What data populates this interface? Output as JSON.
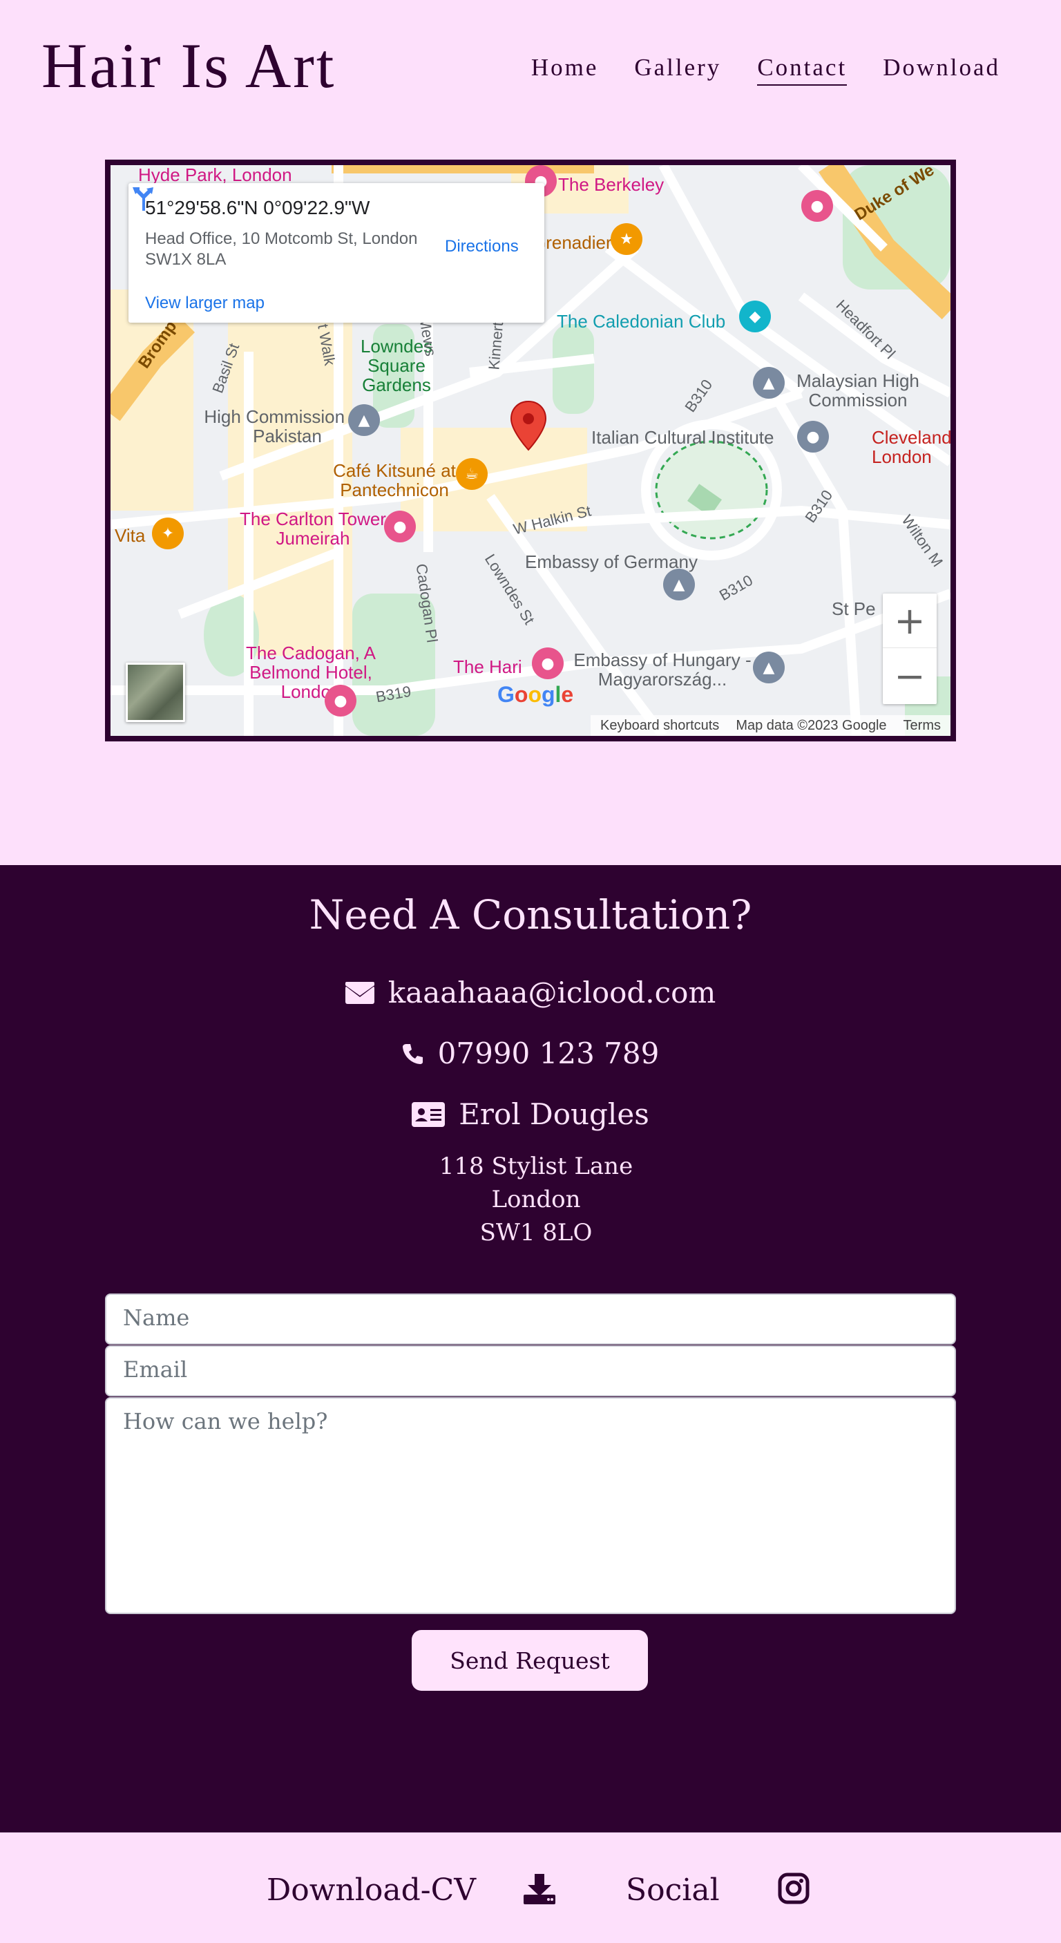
{
  "brand": "Hair Is Art",
  "nav": {
    "items": [
      {
        "label": "Home"
      },
      {
        "label": "Gallery"
      },
      {
        "label": "Contact",
        "active": true
      },
      {
        "label": "Download"
      }
    ]
  },
  "map": {
    "coords": "51°29'58.6\"N 0°09'22.9\"W",
    "address": "Head Office, 10 Motcomb St, London SW1X 8LA",
    "directions_label": "Directions",
    "larger_map_label": "View larger map",
    "zoom_in": "+",
    "zoom_out": "−",
    "footer": {
      "shortcuts": "Keyboard shortcuts",
      "data": "Map data ©2023 Google",
      "terms": "Terms"
    },
    "logo": "Google",
    "places": {
      "berkeley": "The Berkeley",
      "grenadier": "Grenadier",
      "caledonian": "The Caledonian Club",
      "lowndes": "Lowndes Square Gardens",
      "high_commission": "High Commission for Pakistan",
      "malaysian": "Malaysian High Commission",
      "italian": "Italian Cultural Institute",
      "cleveland": "Cleveland London",
      "cafe": "Café Kitsuné at Pantechnicon",
      "carlton": "The Carlton Tower Jumeirah",
      "vita": "Vita",
      "germany": "Embassy of Germany",
      "cadogan": "The Cadogan, A Belmond Hotel, London",
      "hari": "The Hari",
      "hungary": "Embassy of Hungary - Magyarország...",
      "hyde": "Hyde Park, London",
      "st_pe": "St Pe"
    },
    "roads": {
      "duke": "Duke of We",
      "headfort": "Headfort Pl",
      "basil": "Basil St",
      "kinnerton": "Kinnerton St",
      "halkin": "W Halkin St",
      "lowndes_st": "Lowndes St",
      "cadogan_pl": "Cadogan Pl",
      "b310a": "B310",
      "b310b": "B310",
      "b310c": "B310",
      "b319": "B319",
      "wilton": "Wilton M",
      "brompton": "Bromp",
      "walk": "t Walk",
      "mews": "Mews"
    }
  },
  "consultation": {
    "title": "Need A Consultation?",
    "email": "kaaahaaa@iclood.com",
    "phone": "07990 123 789",
    "contact_name": "Erol Dougles",
    "address_lines": [
      "118 Stylist Lane",
      "London",
      "SW1 8LO"
    ],
    "form": {
      "name_placeholder": "Name",
      "email_placeholder": "Email",
      "message_placeholder": "How can we help?",
      "submit_label": "Send Request"
    }
  },
  "footer": {
    "download_label": "Download-CV",
    "social_label": "Social"
  }
}
